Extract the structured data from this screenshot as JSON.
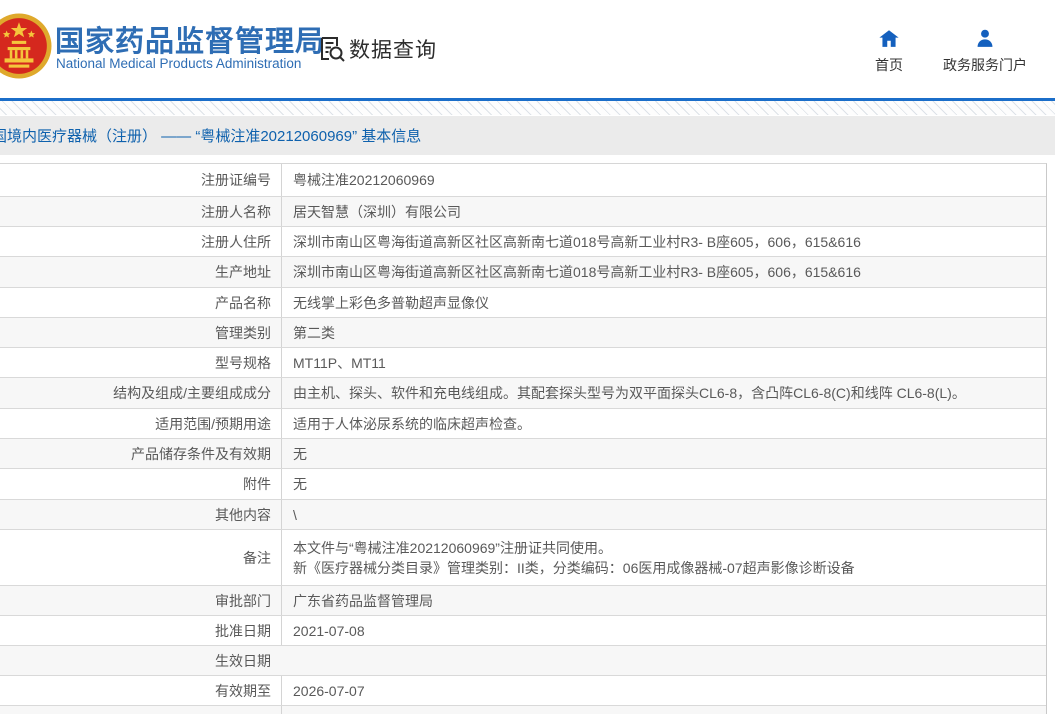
{
  "header": {
    "logo": {
      "title_cn": "国家药品监督管理局",
      "title_en": "National Medical Products Administration"
    },
    "section_label": "数据查询",
    "nav": [
      {
        "label": "首页",
        "icon": "home-icon"
      },
      {
        "label": "政务服务门户",
        "icon": "user-icon"
      }
    ]
  },
  "breadcrumb": {
    "title": "国境内医疗器械（注册） —— “粤械注准20212060969” 基本信息"
  },
  "table": {
    "rows": [
      {
        "label": "注册证编号",
        "value": "粤械注准20212060969"
      },
      {
        "label": "注册人名称",
        "value": "居天智慧（深圳）有限公司"
      },
      {
        "label": "注册人住所",
        "value": "深圳市南山区粤海街道高新区社区高新南七道018号高新工业村R3- B座605，606，615&616"
      },
      {
        "label": "生产地址",
        "value": "深圳市南山区粤海街道高新区社区高新南七道018号高新工业村R3- B座605，606，615&616"
      },
      {
        "label": "产品名称",
        "value": "无线掌上彩色多普勒超声显像仪"
      },
      {
        "label": "管理类别",
        "value": "第二类"
      },
      {
        "label": "型号规格",
        "value": "MT11P、MT11"
      },
      {
        "label": "结构及组成/主要组成成分",
        "value": "由主机、探头、软件和充电线组成。其配套探头型号为双平面探头CL6-8，含凸阵CL6-8(C)和线阵 CL6-8(L)。"
      },
      {
        "label": "适用范围/预期用途",
        "value": "适用于人体泌尿系统的临床超声检查。"
      },
      {
        "label": "产品储存条件及有效期",
        "value": "无"
      },
      {
        "label": "附件",
        "value": "无"
      },
      {
        "label": "其他内容",
        "value": "\\"
      },
      {
        "label": "备注",
        "lines": [
          "本文件与“粤械注准20212060969”注册证共同使用。",
          "新《医疗器械分类目录》管理类别：II类，分类编码：06医用成像器械-07超声影像诊断设备"
        ]
      },
      {
        "label": "审批部门",
        "value": "广东省药品监督管理局"
      },
      {
        "label": "批准日期",
        "value": "2021-07-08"
      },
      {
        "label": "生效日期",
        "value": ""
      },
      {
        "label": "有效期至",
        "value": "2026-07-07"
      }
    ]
  },
  "colors": {
    "brand_blue": "#2e6db4",
    "accent_blue": "#1b6ec9",
    "icon_blue": "#1460be",
    "title_text_blue": "#0e61ad",
    "title_bar_bg": "#ebebeb",
    "row_alt_bg": "#f7f7f7",
    "border": "#d6d6d6",
    "text": "#595959",
    "emblem_red": "#d5281e",
    "emblem_gold": "#e8b32a"
  }
}
